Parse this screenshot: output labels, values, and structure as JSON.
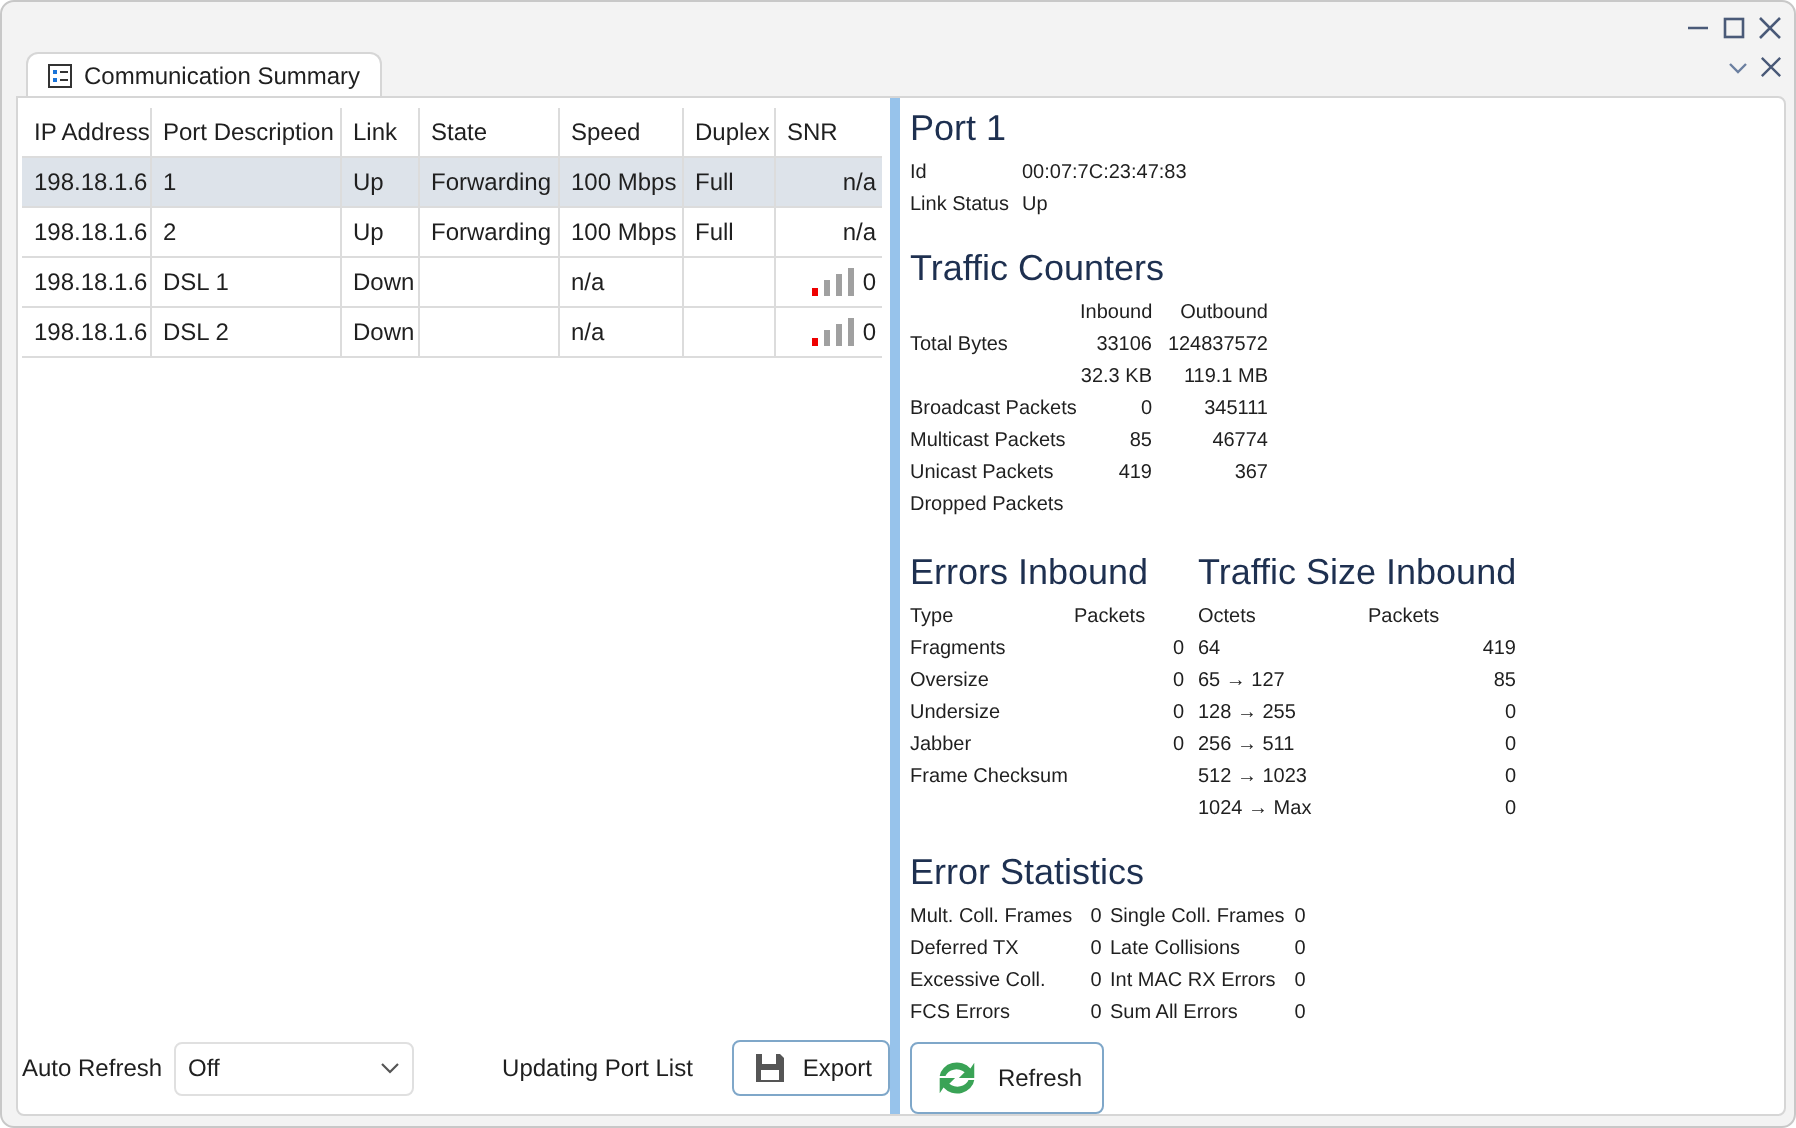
{
  "tab": {
    "title": "Communication Summary"
  },
  "table": {
    "columns": [
      "IP Address",
      "Port Description",
      "Link",
      "State",
      "Speed",
      "Duplex",
      "SNR"
    ],
    "rows": [
      {
        "selected": true,
        "cells": [
          "198.18.1.6",
          "1",
          "Up",
          "Forwarding",
          "100 Mbps",
          "Full"
        ],
        "snr": {
          "kind": "text",
          "value": "n/a"
        }
      },
      {
        "selected": false,
        "cells": [
          "198.18.1.6",
          "2",
          "Up",
          "Forwarding",
          "100 Mbps",
          "Full"
        ],
        "snr": {
          "kind": "text",
          "value": "n/a"
        }
      },
      {
        "selected": false,
        "cells": [
          "198.18.1.6",
          "DSL 1",
          "Down",
          "",
          "n/a",
          ""
        ],
        "snr": {
          "kind": "signal",
          "value": "0"
        }
      },
      {
        "selected": false,
        "cells": [
          "198.18.1.6",
          "DSL 2",
          "Down",
          "",
          "n/a",
          ""
        ],
        "snr": {
          "kind": "signal",
          "value": "0"
        }
      }
    ]
  },
  "auto_refresh": {
    "label": "Auto Refresh",
    "value": "Off"
  },
  "status": "Updating Port List",
  "export_button": "Export",
  "details": {
    "title": "Port 1",
    "fields": [
      {
        "label": "Id",
        "value": "00:07:7C:23:47:83"
      },
      {
        "label": "Link Status",
        "value": "Up"
      }
    ],
    "traffic_counters": {
      "title": "Traffic Counters",
      "columns": [
        "Inbound",
        "Outbound"
      ],
      "rows": [
        {
          "label": "Total Bytes",
          "inbound": "33106",
          "outbound": "124837572"
        },
        {
          "inbound": "32.3 KB",
          "outbound": "119.1 MB"
        },
        {
          "label": "Broadcast Packets",
          "inbound": "0",
          "outbound": "345111"
        },
        {
          "label": "Multicast Packets",
          "inbound": "85",
          "outbound": "46774"
        },
        {
          "label": "Unicast Packets",
          "inbound": "419",
          "outbound": "367"
        },
        {
          "label": "Dropped Packets"
        }
      ]
    },
    "errors_inbound": {
      "title": "Errors Inbound",
      "columns": [
        "Type",
        "Packets"
      ],
      "rows": [
        {
          "label": "Fragments",
          "value": "0"
        },
        {
          "label": "Oversize",
          "value": "0"
        },
        {
          "label": "Undersize",
          "value": "0"
        },
        {
          "label": "Jabber",
          "value": "0"
        },
        {
          "label": "Frame Checksum"
        }
      ]
    },
    "traffic_size_inbound": {
      "title": "Traffic Size Inbound",
      "columns": [
        "Octets",
        "Packets"
      ],
      "rows": [
        {
          "range": "64",
          "packets": "419"
        },
        {
          "range": "65 → 127",
          "packets": "85"
        },
        {
          "range": "128 → 255",
          "packets": "0"
        },
        {
          "range": "256 → 511",
          "packets": "0"
        },
        {
          "range": "512 → 1023",
          "packets": "0"
        },
        {
          "range": "1024 → Max",
          "packets": "0"
        }
      ]
    },
    "error_statistics": {
      "title": "Error Statistics",
      "items": [
        {
          "label": "Mult. Coll. Frames",
          "value": "0"
        },
        {
          "label": "Single Coll. Frames",
          "value": "0"
        },
        {
          "label": "Deferred TX",
          "value": "0"
        },
        {
          "label": "Late Collisions",
          "value": "0"
        },
        {
          "label": "Excessive Coll.",
          "value": "0"
        },
        {
          "label": "Int MAC RX Errors",
          "value": "0"
        },
        {
          "label": "FCS Errors",
          "value": "0"
        },
        {
          "label": "Sum All Errors",
          "value": "0"
        }
      ]
    },
    "refresh_button": "Refresh"
  }
}
